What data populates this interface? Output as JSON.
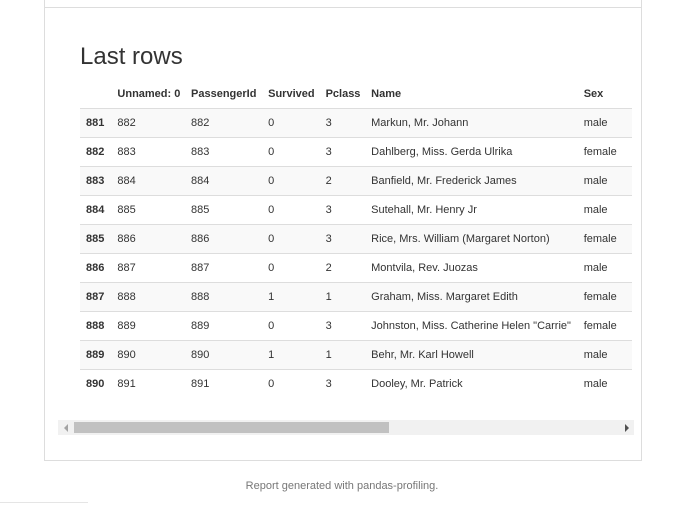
{
  "section": {
    "title": "Last rows"
  },
  "table": {
    "columns": [
      "",
      "Unnamed: 0",
      "PassengerId",
      "Survived",
      "Pclass",
      "Name",
      "Sex"
    ],
    "rows": [
      {
        "index": "881",
        "cells": [
          "882",
          "882",
          "0",
          "3",
          "Markun, Mr. Johann",
          "male"
        ]
      },
      {
        "index": "882",
        "cells": [
          "883",
          "883",
          "0",
          "3",
          "Dahlberg, Miss. Gerda Ulrika",
          "female"
        ]
      },
      {
        "index": "883",
        "cells": [
          "884",
          "884",
          "0",
          "2",
          "Banfield, Mr. Frederick James",
          "male"
        ]
      },
      {
        "index": "884",
        "cells": [
          "885",
          "885",
          "0",
          "3",
          "Sutehall, Mr. Henry Jr",
          "male"
        ]
      },
      {
        "index": "885",
        "cells": [
          "886",
          "886",
          "0",
          "3",
          "Rice, Mrs. William (Margaret Norton)",
          "female"
        ]
      },
      {
        "index": "886",
        "cells": [
          "887",
          "887",
          "0",
          "2",
          "Montvila, Rev. Juozas",
          "male"
        ]
      },
      {
        "index": "887",
        "cells": [
          "888",
          "888",
          "1",
          "1",
          "Graham, Miss. Margaret Edith",
          "female"
        ]
      },
      {
        "index": "888",
        "cells": [
          "889",
          "889",
          "0",
          "3",
          "Johnston, Miss. Catherine Helen \"Carrie\"",
          "female"
        ]
      },
      {
        "index": "889",
        "cells": [
          "890",
          "890",
          "1",
          "1",
          "Behr, Mr. Karl Howell",
          "male"
        ]
      },
      {
        "index": "890",
        "cells": [
          "891",
          "891",
          "0",
          "3",
          "Dooley, Mr. Patrick",
          "male"
        ]
      }
    ]
  },
  "scrollbar": {
    "left_icon": "triangle-left-icon",
    "right_icon": "triangle-right-icon"
  },
  "footer": {
    "prefix": "Report generated with ",
    "link": "pandas-profiling",
    "suffix": "."
  }
}
